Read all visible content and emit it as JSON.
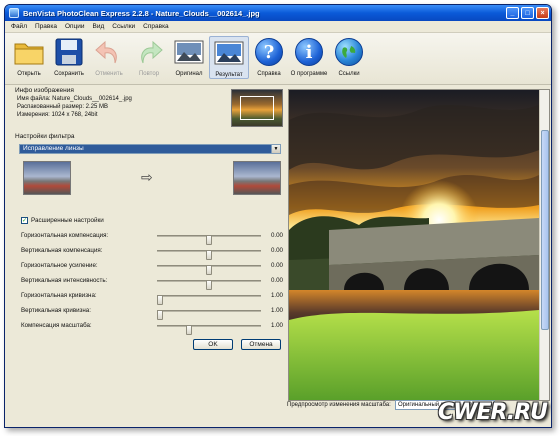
{
  "window": {
    "title": "BenVista PhotoClean Express 2.2.8 - Nature_Clouds__002614_.jpg",
    "controls": [
      "_",
      "□",
      "×"
    ]
  },
  "menu": [
    "Файл",
    "Правка",
    "Опции",
    "Вид",
    "Ссылки",
    "Справка"
  ],
  "toolbar": {
    "open": "Открыть",
    "save": "Сохранить",
    "undo": "Отменить",
    "redo": "Повтор",
    "original": "Оригинал",
    "result": "Результат",
    "help": "Справка",
    "about": "О программе",
    "links": "Ссылки"
  },
  "info": {
    "title": "Инфо изображения",
    "filename": "Имя файла: Nature_Clouds__002614_.jpg",
    "size": "Распакованный размер: 2.25 MB",
    "dimensions": "Измерения: 1024 x 768, 24bit"
  },
  "filter": {
    "title": "Настройки фильтра",
    "selected": "Исправление линзы",
    "arrow": "⇨"
  },
  "advanced": {
    "checkbox_label": "Расширенные настройки",
    "checked": true
  },
  "params": [
    {
      "label": "Горизонтальная компенсация:",
      "value": "0.00",
      "level": 0.5
    },
    {
      "label": "Вертикальная компенсация:",
      "value": "0.00",
      "level": 0.5
    },
    {
      "label": "Горизонтальное усиление:",
      "value": "0.00",
      "level": 0.5
    },
    {
      "label": "Вертикальная интенсивность:",
      "value": "0.00",
      "level": 0.5
    },
    {
      "label": "Горизонтальная кривизна:",
      "value": "1.00",
      "level": 0.0
    },
    {
      "label": "Вертикальная кривизна:",
      "value": "1.00",
      "level": 0.0
    },
    {
      "label": "Компенсация масштаба:",
      "value": "1.00",
      "level": 0.3
    }
  ],
  "buttons": {
    "ok": "OK",
    "cancel": "Отмена"
  },
  "status": {
    "preview_label": "Предпросмотр изменения масштаба:",
    "preview_value": "Оригинальный размер (100%)"
  },
  "watermark": "CWER.RU"
}
